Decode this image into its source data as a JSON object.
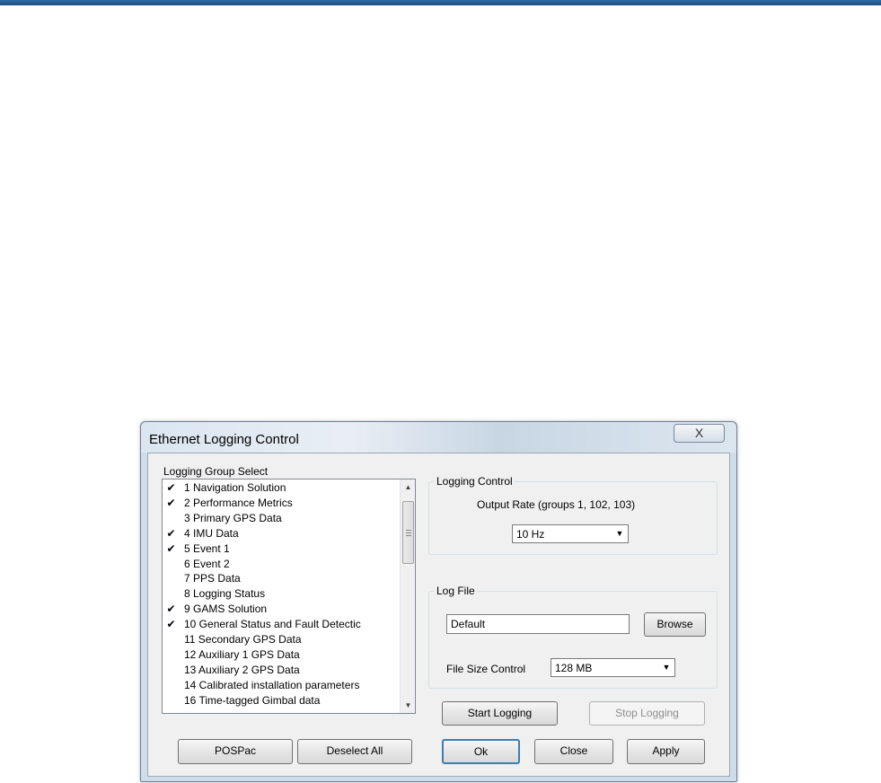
{
  "dialog": {
    "title": "Ethernet Logging Control",
    "close_glyph": "X"
  },
  "group_select": {
    "label": "Logging Group Select",
    "items": [
      {
        "label": "1 Navigation Solution",
        "checked": true
      },
      {
        "label": "2 Performance Metrics",
        "checked": true
      },
      {
        "label": "3 Primary GPS Data",
        "checked": false
      },
      {
        "label": "4 IMU Data",
        "checked": true
      },
      {
        "label": "5 Event 1",
        "checked": true
      },
      {
        "label": "6 Event 2",
        "checked": false
      },
      {
        "label": "7 PPS Data",
        "checked": false
      },
      {
        "label": "8 Logging Status",
        "checked": false
      },
      {
        "label": "9 GAMS Solution",
        "checked": true
      },
      {
        "label": "10 General Status and Fault Detectic",
        "checked": true
      },
      {
        "label": "11 Secondary GPS Data",
        "checked": false
      },
      {
        "label": "12 Auxiliary 1 GPS Data",
        "checked": false
      },
      {
        "label": "13 Auxiliary 2 GPS Data",
        "checked": false
      },
      {
        "label": "14 Calibrated installation parameters",
        "checked": false
      },
      {
        "label": "16 Time-tagged Gimbal data",
        "checked": false
      }
    ],
    "check_glyph": "✔",
    "scroll_up_glyph": "▲",
    "scroll_down_glyph": "▼"
  },
  "logging_control": {
    "title": "Logging Control",
    "output_rate_label": "Output Rate (groups 1, 102, 103)",
    "output_rate_value": "10 Hz",
    "dropdown_glyph": "▼"
  },
  "log_file": {
    "title": "Log File",
    "filename_value": "Default",
    "browse_label": "Browse",
    "file_size_label": "File Size Control",
    "file_size_value": "128 MB",
    "dropdown_glyph": "▼"
  },
  "buttons": {
    "start_logging": "Start Logging",
    "stop_logging": "Stop Logging",
    "pospac": "POSPac",
    "deselect_all": "Deselect All",
    "ok": "Ok",
    "close": "Close",
    "apply": "Apply"
  }
}
